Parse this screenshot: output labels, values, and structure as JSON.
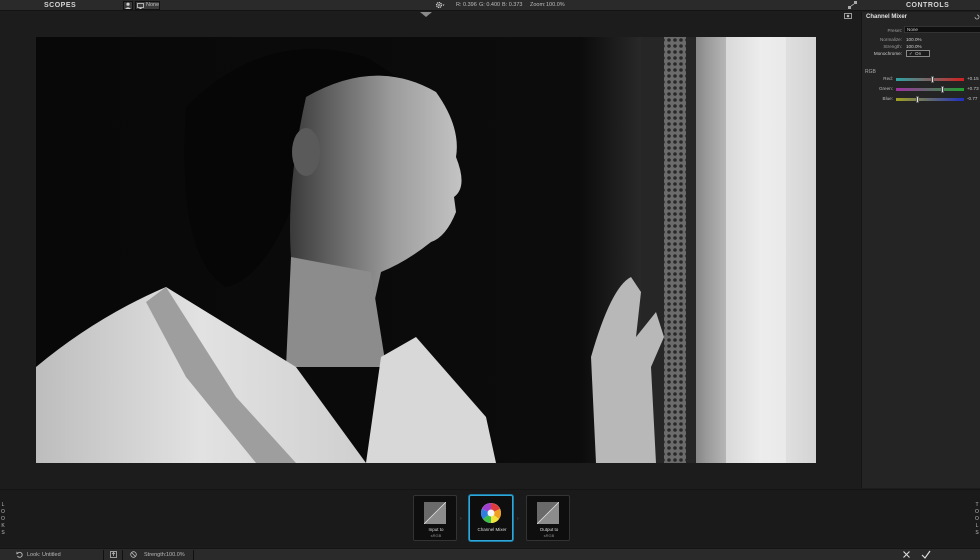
{
  "topbar": {
    "scopes_label": "SCOPES",
    "controls_label": "CONTROLS",
    "layer_value": "None",
    "readout_r": "R: 0.396",
    "readout_g": "G: 0.400",
    "readout_b": "B: 0.373",
    "zoom_label": "Zoom:",
    "zoom_value": "100.0%"
  },
  "panel": {
    "title": "Channel Mixer",
    "preset_label": "Preset:",
    "preset_value": "None",
    "normalize_label": "Normalize:",
    "normalize_value": "100.0%",
    "strength_label": "Strength:",
    "strength_value": "100.0%",
    "monochrome_label": "Monochrome:",
    "monochrome_value": "On",
    "rgb_label": "RGB",
    "sliders": [
      {
        "label": "Red:",
        "value": "+0.15",
        "fraction": 0.54,
        "from": "#2ea3a3",
        "to": "#d02020"
      },
      {
        "label": "Green:",
        "value": "+0.73",
        "fraction": 0.68,
        "from": "#a030a0",
        "to": "#20a030"
      },
      {
        "label": "Blue:",
        "value": "-0.77",
        "fraction": 0.31,
        "from": "#a0a020",
        "to": "#2030c0"
      }
    ]
  },
  "strip": {
    "looks_letters": [
      "L",
      "O",
      "O",
      "K",
      "S"
    ],
    "right_letters": [
      "T",
      "O",
      "O",
      "L",
      "S"
    ],
    "nodes": [
      {
        "label": "Input to",
        "sub": "sRGB"
      },
      {
        "label": "Channel Mixer",
        "sub": ""
      },
      {
        "label": "Output to",
        "sub": "sRGB"
      }
    ]
  },
  "statusbar": {
    "look_label": "Look:",
    "look_value": "Untitled",
    "strength_label": "Strength:",
    "strength_value": "100.0%"
  },
  "icons": {
    "user": "user-icon",
    "monitor": "monitor-icon",
    "gear": "gear-icon",
    "camera": "camera-icon",
    "undo": "undo-icon",
    "export": "export-icon",
    "reset": "reset-icon",
    "cancel": "close-icon",
    "apply": "check-icon"
  }
}
